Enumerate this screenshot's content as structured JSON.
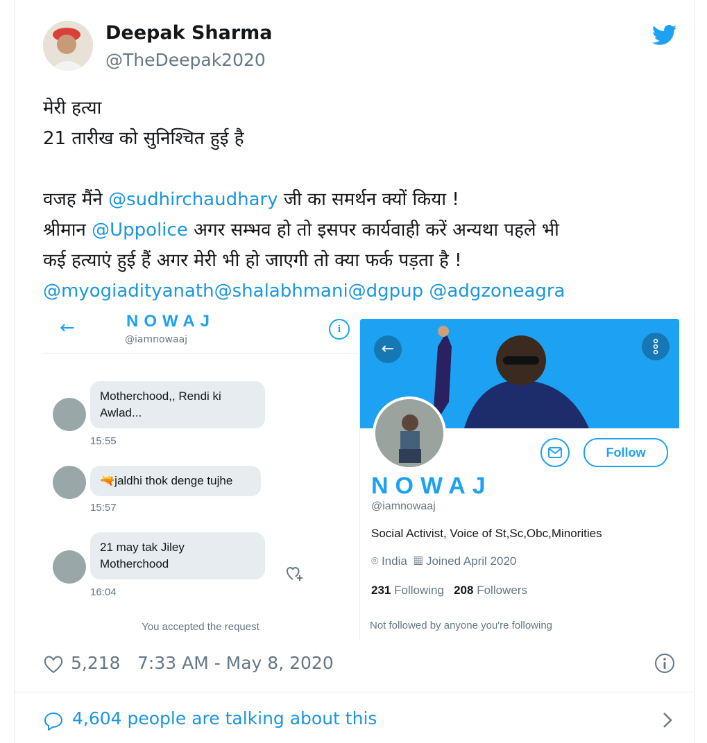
{
  "author": {
    "name": "Deepak Sharma",
    "handle": "@TheDeepak2020"
  },
  "tweet": {
    "line1": "मेरी हत्या",
    "line2": "21 तारीख को सुनिश्चित हुई है",
    "line3_pre": "वजह मैंने ",
    "line3_mention": "@sudhirchaudhary",
    "line3_post": " जी का समर्थन क्यों किया !",
    "line4_pre": "श्रीमान ",
    "line4_mention": "@Uppolice",
    "line4_post": " अगर सम्भव हो तो इसपर कार्यवाही करें अन्यथा पहले भी",
    "line5": "कई हत्याएं हुई हैं अगर मेरी भी हो जाएगी तो क्या फर्क पड़ता है !",
    "line6_mentions": "@myogiadityanath@shalabhmani@dgpup @adgzoneagra"
  },
  "dm_screenshot": {
    "title": "NOWAJ",
    "subtitle": "@iamnowaaj",
    "messages": [
      {
        "text": "Motherchood,, Rendi ki Awlad...",
        "time": "15:55"
      },
      {
        "text": "🔫jaldhi thok denge tujhe",
        "time": "15:57"
      },
      {
        "text": "21 may tak Jiley Motherchood",
        "time": "16:04"
      }
    ],
    "accepted_text": "You accepted the request"
  },
  "profile_screenshot": {
    "follow_label": "Follow",
    "name": "NOWAJ",
    "handle": "@iamnowaaj",
    "bio": "Social Activist, Voice of St,Sc,Obc,Minorities",
    "location": "India",
    "joined": "Joined April 2020",
    "following_count": "231",
    "following_label": "Following",
    "followers_count": "208",
    "followers_label": "Followers",
    "not_followed": "Not followed by anyone you're following"
  },
  "footer": {
    "likes": "5,218",
    "datetime": "7:33 AM - May 8, 2020",
    "talking": "4,604 people are talking about this"
  },
  "colors": {
    "twitter_blue": "#1da1f2",
    "link_blue": "#1b95e0",
    "secondary_text": "#657786"
  },
  "icons": [
    "twitter-bird-icon",
    "heart-icon",
    "info-icon",
    "reply-bubble-icon",
    "chevron-right-icon",
    "back-arrow-icon",
    "more-icon",
    "mail-icon",
    "location-icon",
    "calendar-icon",
    "add-reaction-icon"
  ]
}
